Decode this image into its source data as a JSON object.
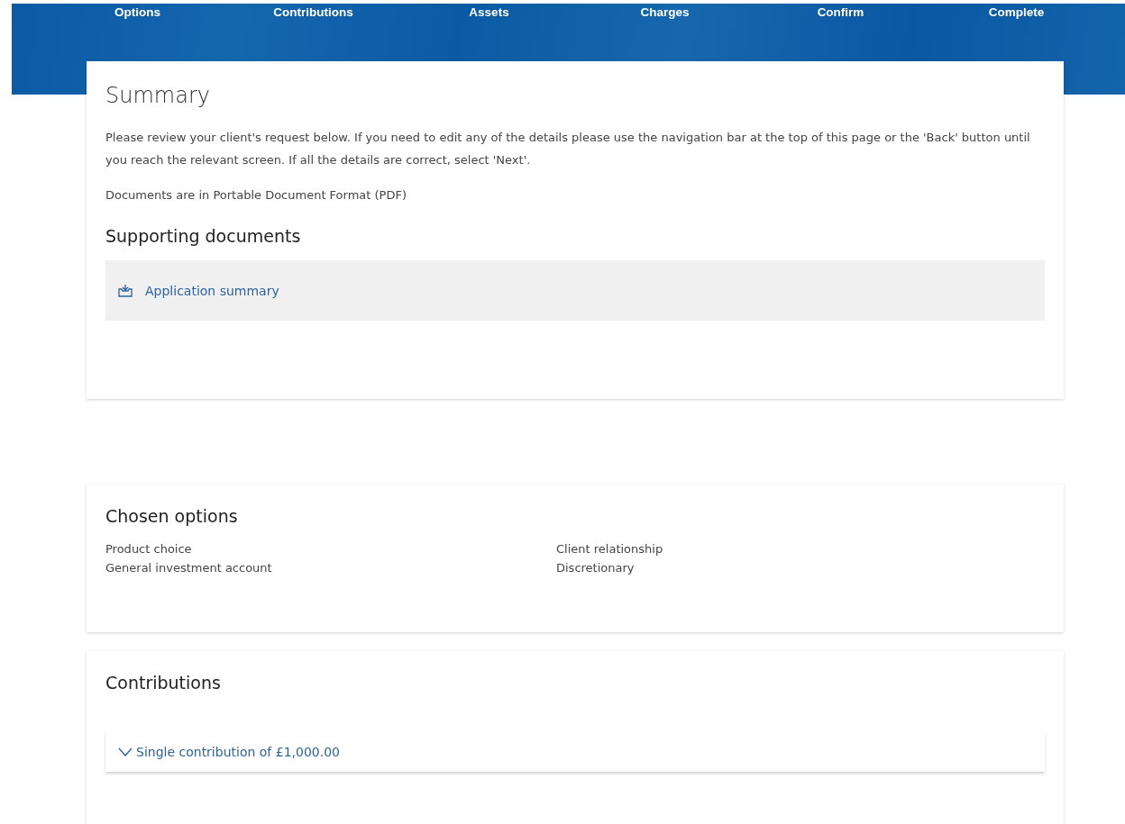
{
  "steps": [
    {
      "label": "Options"
    },
    {
      "label": "Contributions"
    },
    {
      "label": "Assets"
    },
    {
      "label": "Charges"
    },
    {
      "label": "Confirm"
    },
    {
      "label": "Complete"
    }
  ],
  "summary": {
    "title": "Summary",
    "intro": "Please review your client's request below. If you need to edit any of the details please use the navigation bar at the top of this page or the 'Back' button until you reach the relevant screen. If all the details are correct, select 'Next'.",
    "format_note": "Documents are in Portable Document Format (PDF)",
    "documents_heading": "Supporting documents",
    "documents": [
      {
        "label": "Application summary"
      }
    ]
  },
  "chosen_options": {
    "title": "Chosen options",
    "fields": [
      {
        "label": "Product choice",
        "value": "General investment account"
      },
      {
        "label": "Client relationship",
        "value": "Discretionary"
      }
    ]
  },
  "contributions": {
    "title": "Contributions",
    "items": [
      {
        "label": "Single contribution of £1,000.00",
        "expanded": false
      }
    ]
  }
}
